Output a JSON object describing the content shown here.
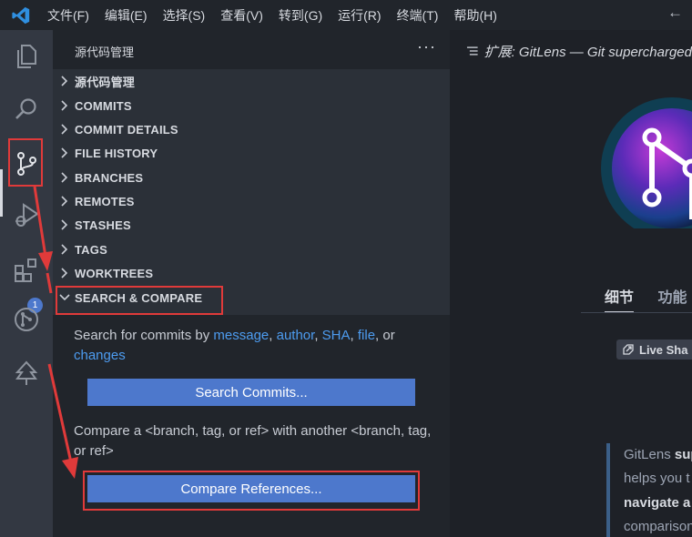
{
  "menubar": {
    "items": [
      "文件(F)",
      "编辑(E)",
      "选择(S)",
      "查看(V)",
      "转到(G)",
      "运行(R)",
      "终端(T)",
      "帮助(H)"
    ]
  },
  "activitybar": {
    "icons": [
      "explorer-icon",
      "search-icon",
      "source-control-icon",
      "run-debug-icon",
      "extensions-icon",
      "gitlens-icon",
      "tree-icon"
    ],
    "extensions_badge": "1"
  },
  "sidebar": {
    "title": "源代码管理",
    "more": "···",
    "sections": [
      {
        "label": "源代码管理",
        "expanded": false
      },
      {
        "label": "COMMITS",
        "expanded": false
      },
      {
        "label": "COMMIT DETAILS",
        "expanded": false
      },
      {
        "label": "FILE HISTORY",
        "expanded": false
      },
      {
        "label": "BRANCHES",
        "expanded": false
      },
      {
        "label": "REMOTES",
        "expanded": false
      },
      {
        "label": "STASHES",
        "expanded": false
      },
      {
        "label": "TAGS",
        "expanded": false
      },
      {
        "label": "WORKTREES",
        "expanded": false
      },
      {
        "label": "SEARCH & COMPARE",
        "expanded": true
      }
    ],
    "search_compare": {
      "search_text_prefix": "Search for commits by",
      "link_message": "message",
      "sep1": ",",
      "link_author": "author",
      "sep2": ",",
      "link_sha": "SHA",
      "sep3": ",",
      "link_file": "file",
      "sep4": ", or",
      "link_changes": "changes",
      "search_button": "Search Commits...",
      "compare_text": "Compare a <branch, tag, or ref> with another <branch, tag, or ref>",
      "compare_button": "Compare References..."
    }
  },
  "editor": {
    "tab_title": "扩展: GitLens — Git supercharged",
    "tab_details": "细节",
    "tab_features": "功能",
    "live_share": "Live Sha",
    "description_lines": [
      {
        "plain": "GitLens ",
        "bold": "sup"
      },
      {
        "plain": "helps you t",
        "bold": ""
      },
      {
        "plain": "",
        "bold": "navigate a"
      },
      {
        "plain": "comparison",
        "bold": ""
      }
    ]
  },
  "colors": {
    "accent_button": "#4d78cc",
    "link": "#4d9cf0",
    "annotation_red": "#e03a3a"
  }
}
